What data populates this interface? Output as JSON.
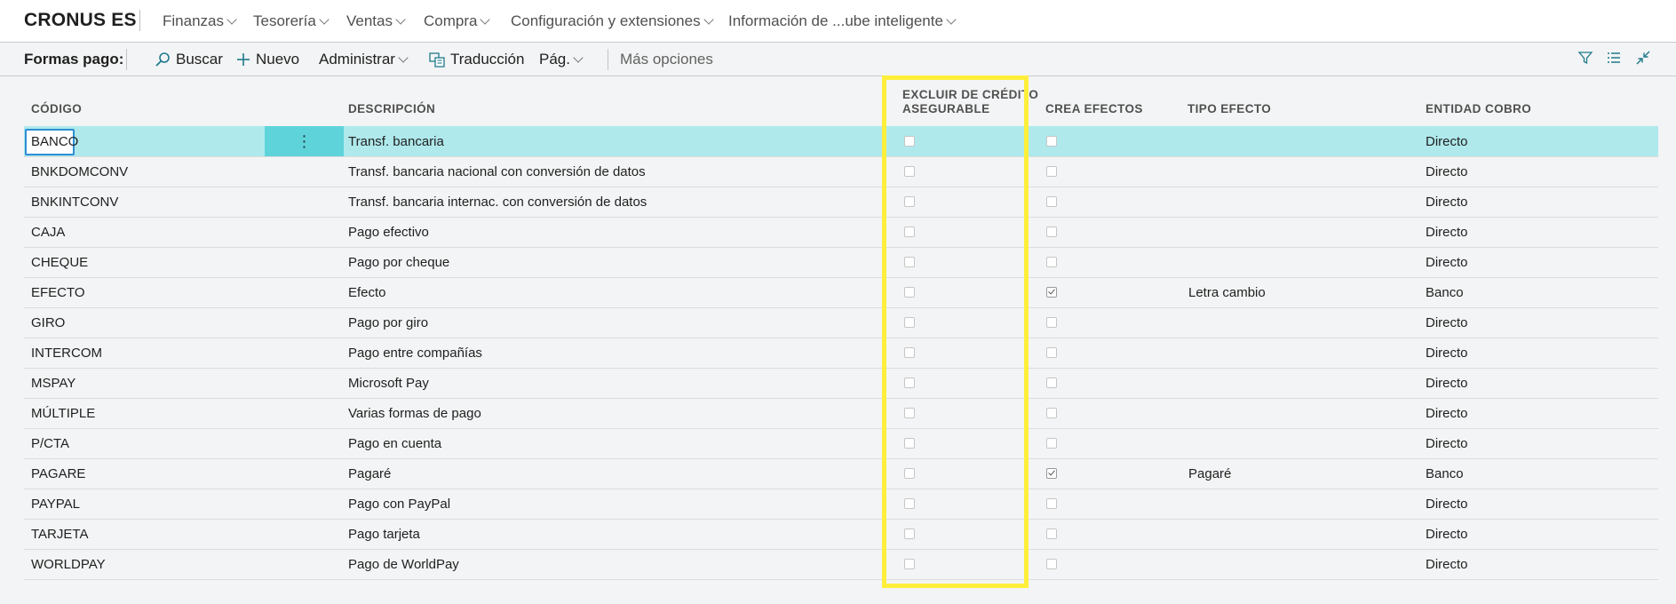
{
  "app": {
    "company": "CRONUS ES"
  },
  "topnav": [
    {
      "label": "Finanzas"
    },
    {
      "label": "Tesorería"
    },
    {
      "label": "Ventas"
    },
    {
      "label": "Compra"
    },
    {
      "label": "Configuración y extensiones"
    },
    {
      "label": "Información de ...ube inteligente"
    }
  ],
  "actionbar": {
    "title": "Formas pago:",
    "search": "Buscar",
    "new": "Nuevo",
    "manage": "Administrar",
    "translation": "Traducción",
    "page": "Pág.",
    "more": "Más opciones"
  },
  "columns": {
    "code": "CÓDIGO",
    "description": "DESCRIPCIÓN",
    "exclude_line1": "EXCLUIR DE CRÉDITO",
    "exclude_line2": "ASEGURABLE",
    "creates_bills": "CREA EFECTOS",
    "bill_type": "TIPO EFECTO",
    "collection_agent": "ENTIDAD COBRO"
  },
  "rows": [
    {
      "code": "BANCO",
      "description": "Transf. bancaria",
      "exclude": false,
      "creates": false,
      "bill_type": "",
      "agent": "Directo"
    },
    {
      "code": "BNKDOMCONV",
      "description": "Transf. bancaria nacional con conversión de datos",
      "exclude": false,
      "creates": false,
      "bill_type": "",
      "agent": "Directo"
    },
    {
      "code": "BNKINTCONV",
      "description": "Transf. bancaria internac. con conversión de datos",
      "exclude": false,
      "creates": false,
      "bill_type": "",
      "agent": "Directo"
    },
    {
      "code": "CAJA",
      "description": "Pago efectivo",
      "exclude": false,
      "creates": false,
      "bill_type": "",
      "agent": "Directo"
    },
    {
      "code": "CHEQUE",
      "description": "Pago por cheque",
      "exclude": false,
      "creates": false,
      "bill_type": "",
      "agent": "Directo"
    },
    {
      "code": "EFECTO",
      "description": "Efecto",
      "exclude": false,
      "creates": true,
      "bill_type": "Letra cambio",
      "agent": "Banco"
    },
    {
      "code": "GIRO",
      "description": "Pago por giro",
      "exclude": false,
      "creates": false,
      "bill_type": "",
      "agent": "Directo"
    },
    {
      "code": "INTERCOM",
      "description": "Pago entre compañías",
      "exclude": false,
      "creates": false,
      "bill_type": "",
      "agent": "Directo"
    },
    {
      "code": "MSPAY",
      "description": "Microsoft Pay",
      "exclude": false,
      "creates": false,
      "bill_type": "",
      "agent": "Directo"
    },
    {
      "code": "MÚLTIPLE",
      "description": "Varias formas de pago",
      "exclude": false,
      "creates": false,
      "bill_type": "",
      "agent": "Directo"
    },
    {
      "code": "P/CTA",
      "description": "Pago en cuenta",
      "exclude": false,
      "creates": false,
      "bill_type": "",
      "agent": "Directo"
    },
    {
      "code": "PAGARE",
      "description": "Pagaré",
      "exclude": false,
      "creates": true,
      "bill_type": "Pagaré",
      "agent": "Banco"
    },
    {
      "code": "PAYPAL",
      "description": "Pago con PayPal",
      "exclude": false,
      "creates": false,
      "bill_type": "",
      "agent": "Directo"
    },
    {
      "code": "TARJETA",
      "description": "Pago tarjeta",
      "exclude": false,
      "creates": false,
      "bill_type": "",
      "agent": "Directo"
    },
    {
      "code": "WORLDPAY",
      "description": "Pago de WorldPay",
      "exclude": false,
      "creates": false,
      "bill_type": "",
      "agent": "Directo"
    }
  ],
  "selected_row": 0,
  "row_menu_icon": "more-vertical-icon",
  "colors": {
    "selected_row": "#afe9ec",
    "row_menu": "#5fd3da",
    "accent": "#1f7a8c",
    "highlight": "#ffef3b"
  }
}
